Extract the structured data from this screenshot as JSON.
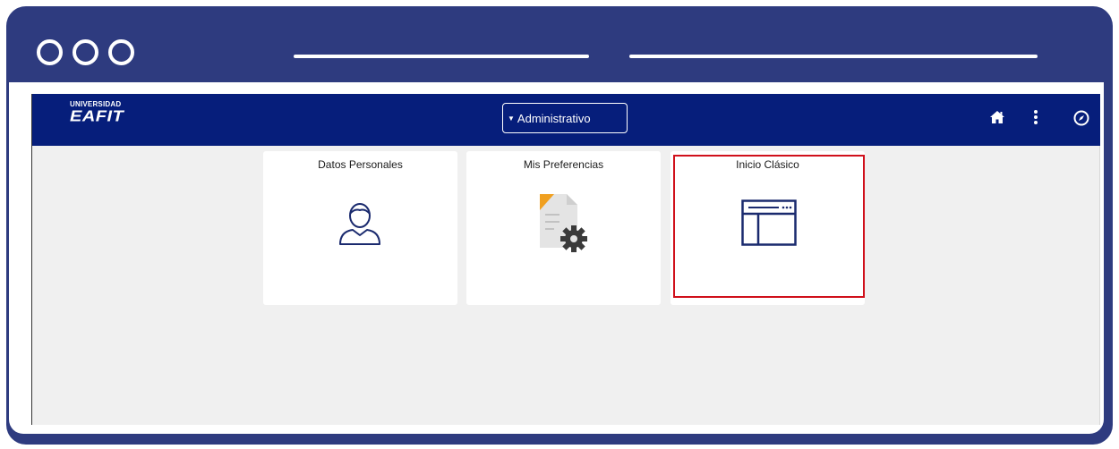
{
  "header": {
    "logo_small": "UNIVERSIDAD",
    "logo_big": "EAFIT",
    "dropdown_label": "Administrativo"
  },
  "tiles": [
    {
      "title": "Datos Personales",
      "icon": "person-icon"
    },
    {
      "title": "Mis Preferencias",
      "icon": "preferences-gear-icon"
    },
    {
      "title": "Inicio Clásico",
      "icon": "classic-layout-icon"
    }
  ],
  "colors": {
    "frame": "#2e3b7f",
    "topbar": "#061e7b",
    "highlight": "#d0101b",
    "icon_navy": "#061e7b"
  }
}
